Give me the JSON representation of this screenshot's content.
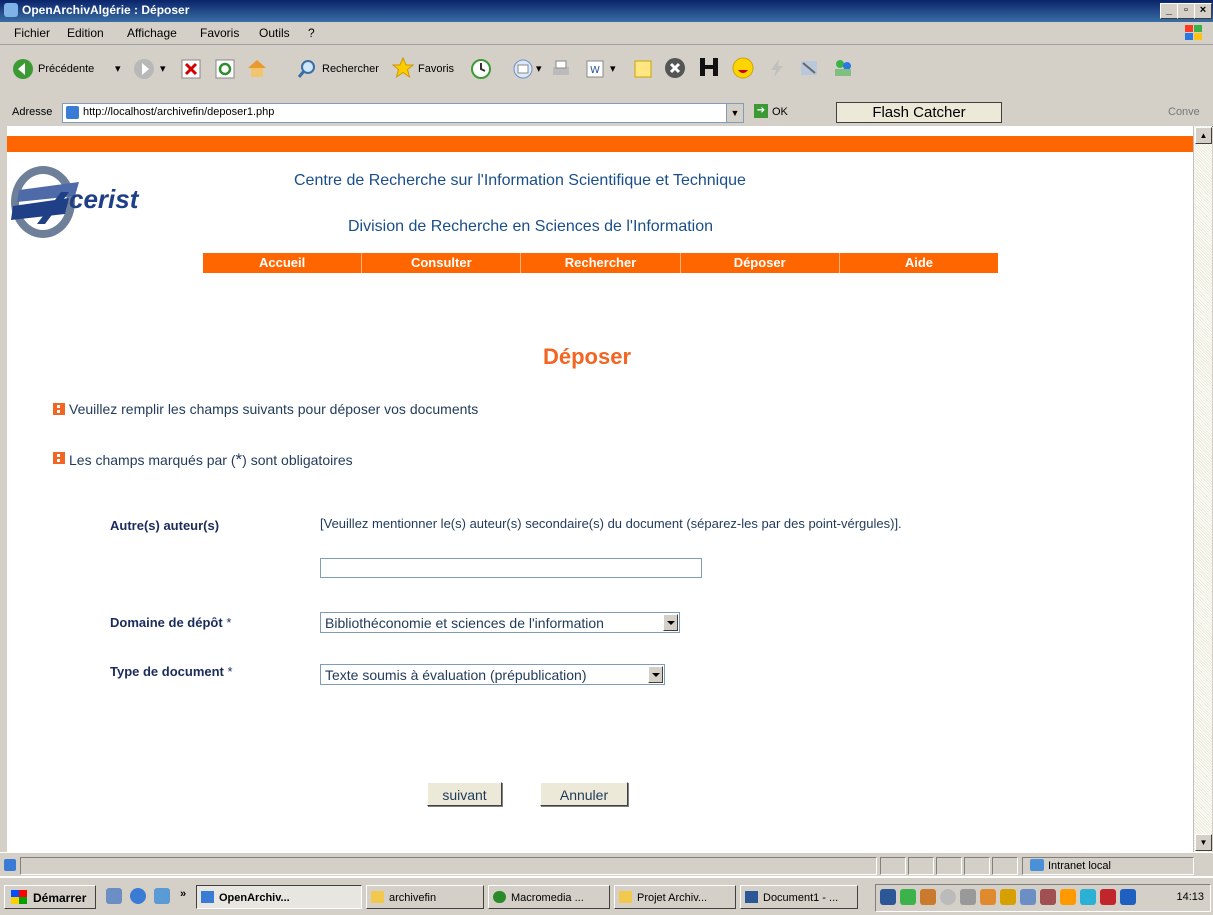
{
  "window": {
    "title": "OpenArchivAlgérie : Déposer"
  },
  "menu": [
    "Fichier",
    "Edition",
    "Affichage",
    "Favoris",
    "Outils",
    "?"
  ],
  "toolbar": {
    "back_label": "Précédente",
    "search_label": "Rechercher",
    "favorites_label": "Favoris"
  },
  "address": {
    "label": "Adresse",
    "url": "http://localhost/archivefin/deposer1.php",
    "go_label": "OK",
    "flash_label": "Flash Catcher",
    "conv_label": "Conve"
  },
  "page": {
    "header_line1": "Centre de Recherche sur l'Information Scientifique et Technique",
    "header_line2": "Division de Recherche en Sciences de l'Information",
    "nav": [
      "Accueil",
      "Consulter",
      "Rechercher",
      "Déposer",
      "Aide"
    ],
    "title": "Déposer",
    "info1": "Veuillez remplir les champs suivants pour déposer vos documents",
    "info2_prefix": "Les champs marqués par (",
    "info2_star": "*",
    "info2_suffix": ") sont obligatoires",
    "fields": {
      "autres_label": "Autre(s) auteur(s)",
      "autres_hint": "[Veuillez mentionner le(s) auteur(s) secondaire(s) du document (séparez-les par des point-vérgules)].",
      "autres_value": "",
      "domaine_label": "Domaine de dépôt",
      "domaine_value": "Bibliothéconomie et sciences de l'information",
      "type_label": "Type de document",
      "type_value": "Texte soumis à évaluation (prépublication)",
      "required_mark": "*"
    },
    "buttons": {
      "next": "suivant",
      "cancel": "Annuler"
    }
  },
  "status": {
    "zone": "Intranet local"
  },
  "taskbar": {
    "start": "Démarrer",
    "apps": [
      "OpenArchiv...",
      "archivefin",
      "Macromedia ...",
      "Projet Archiv...",
      "Document1 - ..."
    ],
    "clock": "14:13"
  },
  "colors": {
    "orange": "#ff6600",
    "title_orange": "#f26522",
    "navy": "#1a2b5c",
    "header_blue": "#1a4e8a"
  }
}
